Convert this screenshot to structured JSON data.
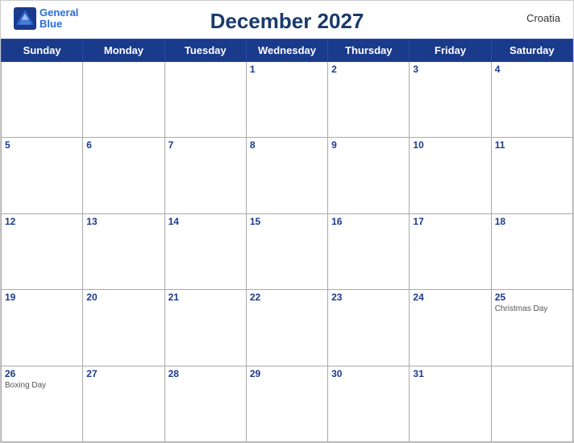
{
  "header": {
    "title": "December 2027",
    "country": "Croatia",
    "logo_general": "General",
    "logo_blue": "Blue"
  },
  "weekdays": [
    "Sunday",
    "Monday",
    "Tuesday",
    "Wednesday",
    "Thursday",
    "Friday",
    "Saturday"
  ],
  "weeks": [
    [
      {
        "day": null,
        "holiday": null
      },
      {
        "day": null,
        "holiday": null
      },
      {
        "day": null,
        "holiday": null
      },
      {
        "day": "1",
        "holiday": null
      },
      {
        "day": "2",
        "holiday": null
      },
      {
        "day": "3",
        "holiday": null
      },
      {
        "day": "4",
        "holiday": null
      }
    ],
    [
      {
        "day": "5",
        "holiday": null
      },
      {
        "day": "6",
        "holiday": null
      },
      {
        "day": "7",
        "holiday": null
      },
      {
        "day": "8",
        "holiday": null
      },
      {
        "day": "9",
        "holiday": null
      },
      {
        "day": "10",
        "holiday": null
      },
      {
        "day": "11",
        "holiday": null
      }
    ],
    [
      {
        "day": "12",
        "holiday": null
      },
      {
        "day": "13",
        "holiday": null
      },
      {
        "day": "14",
        "holiday": null
      },
      {
        "day": "15",
        "holiday": null
      },
      {
        "day": "16",
        "holiday": null
      },
      {
        "day": "17",
        "holiday": null
      },
      {
        "day": "18",
        "holiday": null
      }
    ],
    [
      {
        "day": "19",
        "holiday": null
      },
      {
        "day": "20",
        "holiday": null
      },
      {
        "day": "21",
        "holiday": null
      },
      {
        "day": "22",
        "holiday": null
      },
      {
        "day": "23",
        "holiday": null
      },
      {
        "day": "24",
        "holiday": null
      },
      {
        "day": "25",
        "holiday": "Christmas Day"
      }
    ],
    [
      {
        "day": "26",
        "holiday": "Boxing Day"
      },
      {
        "day": "27",
        "holiday": null
      },
      {
        "day": "28",
        "holiday": null
      },
      {
        "day": "29",
        "holiday": null
      },
      {
        "day": "30",
        "holiday": null
      },
      {
        "day": "31",
        "holiday": null
      },
      {
        "day": null,
        "holiday": null
      }
    ]
  ]
}
